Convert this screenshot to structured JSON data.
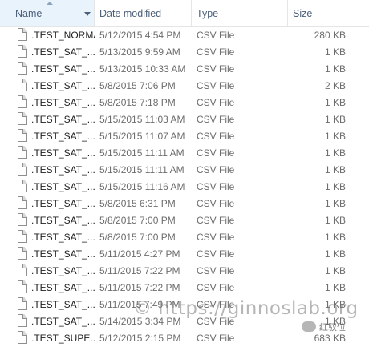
{
  "columns": {
    "name": "Name",
    "date": "Date modified",
    "type": "Type",
    "size": "Size"
  },
  "files": [
    {
      "name": ".TEST_NORMAL...",
      "date": "5/12/2015 4:54 PM",
      "type": "CSV File",
      "size": "280 KB"
    },
    {
      "name": ".TEST_SAT_...",
      "date": "5/13/2015 9:59 AM",
      "type": "CSV File",
      "size": "1 KB"
    },
    {
      "name": ".TEST_SAT_...",
      "date": "5/13/2015 10:33 AM",
      "type": "CSV File",
      "size": "1 KB"
    },
    {
      "name": ".TEST_SAT_...",
      "date": "5/8/2015 7:06 PM",
      "type": "CSV File",
      "size": "2 KB"
    },
    {
      "name": ".TEST_SAT_...",
      "date": "5/8/2015 7:18 PM",
      "type": "CSV File",
      "size": "1 KB"
    },
    {
      "name": ".TEST_SAT_...",
      "date": "5/15/2015 11:03 AM",
      "type": "CSV File",
      "size": "1 KB"
    },
    {
      "name": ".TEST_SAT_...",
      "date": "5/15/2015 11:07 AM",
      "type": "CSV File",
      "size": "1 KB"
    },
    {
      "name": ".TEST_SAT_...",
      "date": "5/15/2015 11:11 AM",
      "type": "CSV File",
      "size": "1 KB"
    },
    {
      "name": ".TEST_SAT_...",
      "date": "5/15/2015 11:11 AM",
      "type": "CSV File",
      "size": "1 KB"
    },
    {
      "name": ".TEST_SAT_...",
      "date": "5/15/2015 11:16 AM",
      "type": "CSV File",
      "size": "1 KB"
    },
    {
      "name": ".TEST_SAT_...",
      "date": "5/8/2015 6:31 PM",
      "type": "CSV File",
      "size": "1 KB"
    },
    {
      "name": ".TEST_SAT_...",
      "date": "5/8/2015 7:00 PM",
      "type": "CSV File",
      "size": "1 KB"
    },
    {
      "name": ".TEST_SAT_...",
      "date": "5/8/2015 7:00 PM",
      "type": "CSV File",
      "size": "1 KB"
    },
    {
      "name": ".TEST_SAT_...",
      "date": "5/11/2015 4:27 PM",
      "type": "CSV File",
      "size": "1 KB"
    },
    {
      "name": ".TEST_SAT_...",
      "date": "5/11/2015 7:22 PM",
      "type": "CSV File",
      "size": "1 KB"
    },
    {
      "name": ".TEST_SAT_...",
      "date": "5/11/2015 7:22 PM",
      "type": "CSV File",
      "size": "1 KB"
    },
    {
      "name": ".TEST_SAT_...",
      "date": "5/11/2015 7:49 PM",
      "type": "CSV File",
      "size": "1 KB"
    },
    {
      "name": ".TEST_SAT_...",
      "date": "5/14/2015 3:34 PM",
      "type": "CSV File",
      "size": "1 KB"
    },
    {
      "name": ".TEST_SUPE...",
      "date": "5/12/2015 2:15 PM",
      "type": "CSV File",
      "size": "683 KB"
    }
  ],
  "icons": {
    "file": "file-icon",
    "sort": "sort-ascending-icon",
    "dropdown": "chevron-down-icon",
    "watermark_logo": "wechat-icon"
  },
  "watermark": {
    "text": "© https://ginnoslab.org",
    "account": "红驭位"
  },
  "colors": {
    "header_text": "#4c607a",
    "sorted_column_bg": "#e9f3fc",
    "row_text": "#1e1e1e",
    "detail_text": "#6d6d6d"
  }
}
